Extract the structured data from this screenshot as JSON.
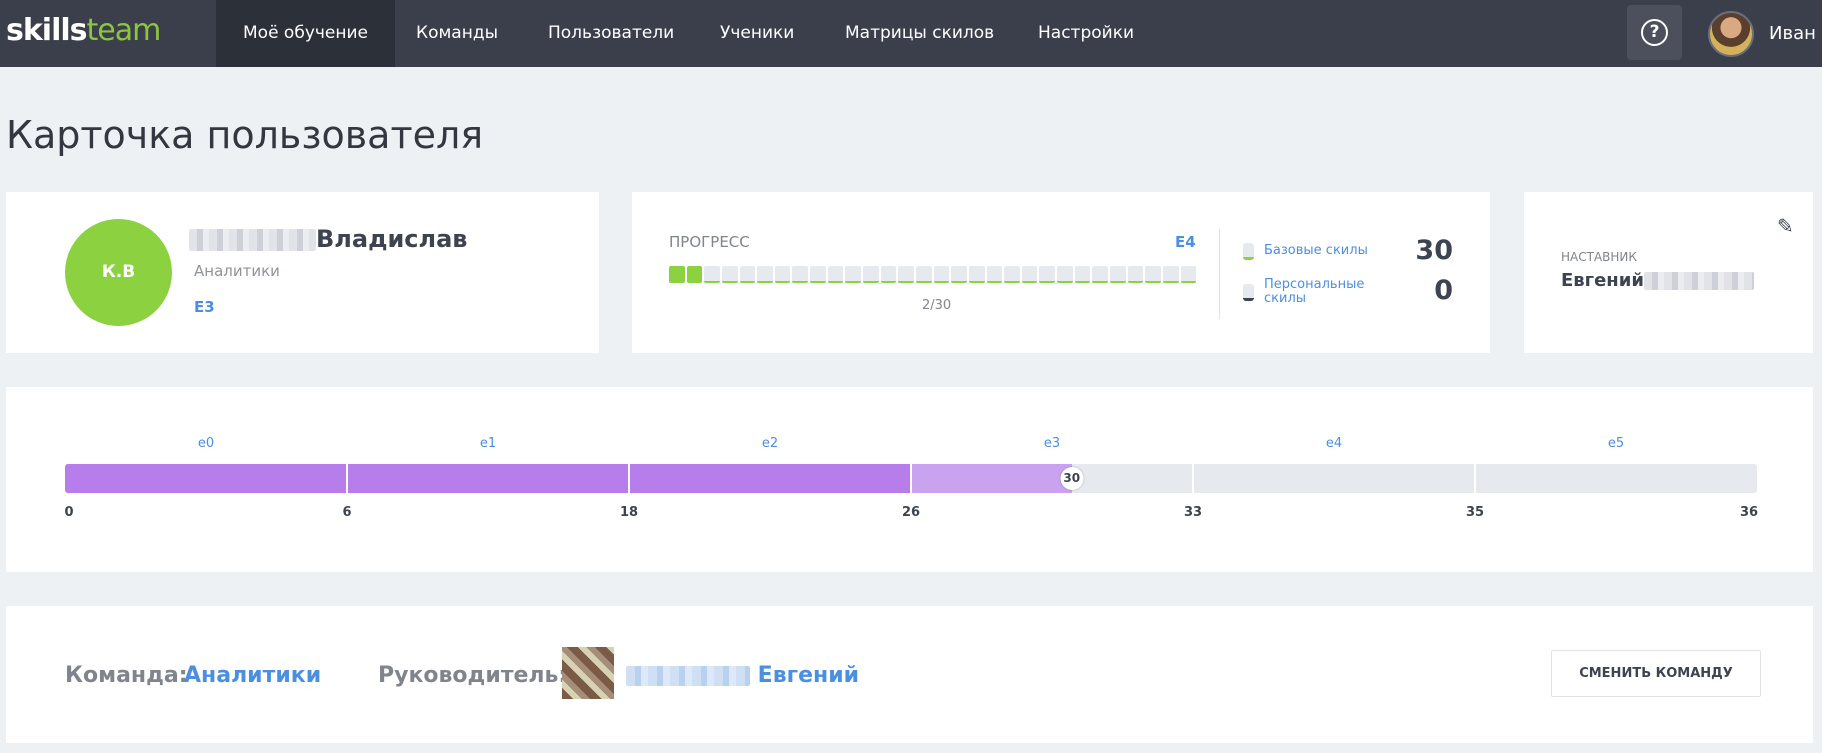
{
  "app": {
    "logo_part1": "skills",
    "logo_part2": "team"
  },
  "nav": {
    "items": [
      {
        "label": "Моё обучение",
        "active": true
      },
      {
        "label": "Команды"
      },
      {
        "label": "Пользователи"
      },
      {
        "label": "Ученики"
      },
      {
        "label": "Матрицы скилов"
      },
      {
        "label": "Настройки"
      }
    ],
    "help_glyph": "?",
    "user_name": "Иван"
  },
  "page": {
    "title": "Карточка пользователя"
  },
  "user": {
    "initials": "К.В",
    "name": "Владислав",
    "department": "Аналитики",
    "level": "E3"
  },
  "progress": {
    "label": "ПРОГРЕСС",
    "next_level": "E4",
    "completed": 2,
    "total": 30,
    "count_text": "2/30",
    "legend": [
      {
        "label": "Базовые скилы",
        "value": "30"
      },
      {
        "label": "Персональные скилы",
        "value": "0"
      }
    ]
  },
  "mentor": {
    "label": "НАСТАВНИК",
    "name": "Евгений"
  },
  "levels": {
    "labels": [
      "e0",
      "e1",
      "e2",
      "e3",
      "e4",
      "e5"
    ],
    "ticks": [
      "0",
      "6",
      "18",
      "26",
      "33",
      "35",
      "36"
    ],
    "current_value": "30",
    "completed_segments": 3,
    "current_segment_fraction": 0.57
  },
  "team": {
    "team_label": "Команда:",
    "team_name": "Аналитики",
    "lead_label": "Руководитель:",
    "lead_name": "Евгений",
    "change_button": "СМЕНИТЬ КОМАНДУ"
  },
  "colors": {
    "accent_green": "#8cd13f",
    "accent_blue": "#4a8fe0",
    "level_purple": "#b67deb",
    "level_purple_light": "#caa3f0",
    "nav_bg": "#3a3f4b"
  }
}
